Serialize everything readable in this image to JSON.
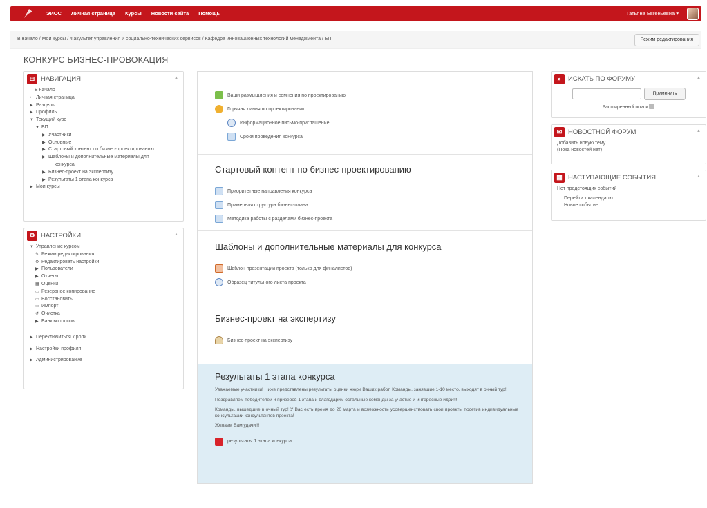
{
  "topnav": {
    "items": [
      "ЭИОС",
      "Личная страница",
      "Курсы",
      "Новости сайта",
      "Помощь"
    ],
    "user": "Татьяна Евгеньевна",
    "user_caret": "▾"
  },
  "breadcrumb": "В начало / Мои курсы / Факультет управления и социально-технических сервисов / Кафедра инновационных технологий менеджмента / БП",
  "edit_mode_button": "Режим редактирования",
  "page_title": "КОНКУРС БИЗНЕС-ПРОВОКАЦИЯ",
  "navigation": {
    "title": "НАВИГАЦИЯ",
    "items": [
      {
        "label": "В начало",
        "marker": ""
      },
      {
        "label": "Личная страница",
        "marker": "•"
      },
      {
        "label": "Разделы",
        "marker": "▶"
      },
      {
        "label": "Профиль",
        "marker": "▶"
      },
      {
        "label": "Текущий курс",
        "marker": "▼"
      },
      {
        "label": "БП",
        "marker": "▼"
      },
      {
        "label": "Участники",
        "marker": "▶"
      },
      {
        "label": "Основные",
        "marker": "▶"
      },
      {
        "label": "Стартовый контент по бизнес-проектированию",
        "marker": "▶"
      },
      {
        "label": "Шаблоны и дополнительные материалы для",
        "marker": "▶"
      },
      {
        "label": "конкурса",
        "marker": ""
      },
      {
        "label": "Бизнес-проект на экспертизу",
        "marker": "▶"
      },
      {
        "label": "Результаты 1 этапа конкурса",
        "marker": "▶"
      },
      {
        "label": "Мои курсы",
        "marker": "▶"
      }
    ]
  },
  "settings": {
    "title": "НАСТРОЙКИ",
    "items": [
      {
        "label": "Управление курсом",
        "marker": "▼"
      },
      {
        "label": "Режим редактирования",
        "marker": "✎"
      },
      {
        "label": "Редактировать настройки",
        "marker": "⚙"
      },
      {
        "label": "Пользователи",
        "marker": "▶"
      },
      {
        "label": "Отчеты",
        "marker": "▶"
      },
      {
        "label": "Оценки",
        "marker": "▦"
      },
      {
        "label": "Резервное копирование",
        "marker": "▭"
      },
      {
        "label": "Восстановить",
        "marker": "▭"
      },
      {
        "label": "Импорт",
        "marker": "▭"
      },
      {
        "label": "Очистка",
        "marker": "↺"
      },
      {
        "label": "Банк вопросов",
        "marker": "▶"
      }
    ],
    "extra": [
      "Переключиться к роли...",
      "Настройки профиля",
      "Администрирование"
    ]
  },
  "sections": {
    "top": [
      {
        "label": "Ваши размышления и сомнения по проектированию",
        "icon": "forum2"
      },
      {
        "label": "Горячая линия по проектированию",
        "icon": "forum"
      },
      {
        "label": "Информационное письмо-приглашение",
        "icon": "url"
      },
      {
        "label": "Сроки проведения конкурса",
        "icon": "page"
      }
    ],
    "s1": {
      "title": "Стартовый контент по бизнес-проектированию",
      "items": [
        "Приоритетные направления конкурса",
        "Примерная структура бизнес-плана",
        "Методика работы с разделами бизнес-проекта"
      ]
    },
    "s2": {
      "title": "Шаблоны и дополнительные материалы для конкурса",
      "items": [
        "Шаблон презентации проекта (только для финалистов)",
        "Образец титульного листа проекта"
      ]
    },
    "s3": {
      "title": "Бизнес-проект на экспертизу",
      "items": [
        "Бизнес-проект на экспертизу"
      ]
    },
    "s4": {
      "title": "Результаты 1 этапа конкурса",
      "paragraphs": [
        "Уважаемые участники! Ниже представлены результаты оценки жюри Ваших работ. Команды, занявшие 1-10 место, выходят в очный тур!",
        "Поздравляем победителей и призеров 1 этапа и благодарим остальные команды за участие и интересные идеи!!!",
        "Команды, вышедшие в очный тур! У Вас есть время до 20 марта и возможность усовершенствовать свои проекты посетив индивидуальные консультации консультантов проекта!",
        "Желаем Вам удачи!!!"
      ],
      "file": "результаты 1 этапа конкурса"
    }
  },
  "forum_search": {
    "title": "ИСКАТЬ ПО ФОРУМУ",
    "input_value": "",
    "apply": "Применить",
    "advanced": "Расширенный поиск"
  },
  "news": {
    "title": "НОВОСТНОЙ ФОРУМ",
    "add": "Добавить новую тему...",
    "none": "(Пока новостей нет)"
  },
  "events": {
    "title": "НАСТУПАЮЩИЕ СОБЫТИЯ",
    "none": "Нет предстоящих событий",
    "calendar": "Перейти к календарю...",
    "new_event": "Новое событие..."
  }
}
